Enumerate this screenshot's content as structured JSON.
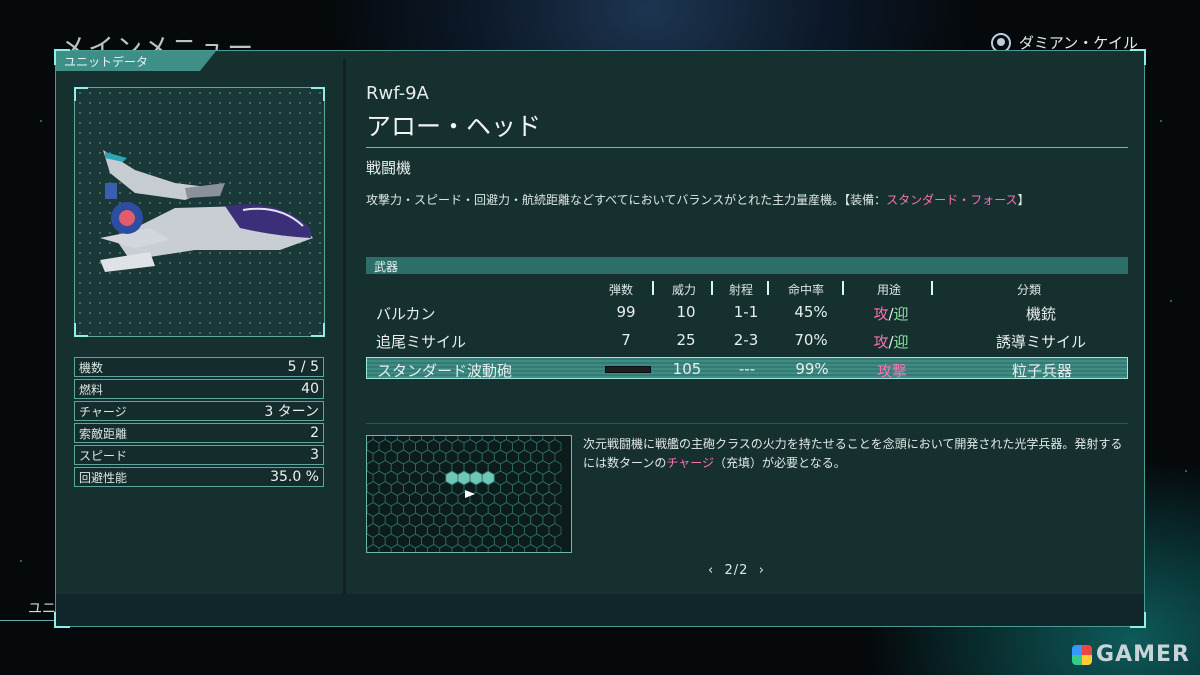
{
  "background": {
    "title": "メインメニュー",
    "pilot_name": "ダミアン・ケイル",
    "bottom_left_text": "ユニ"
  },
  "watermark": "GAMER",
  "panel": {
    "tab_label": "ユニットデータ",
    "unit_image_icon": "r9-fighter-ship",
    "stats": [
      {
        "label": "機数",
        "value": "5 / 5"
      },
      {
        "label": "燃料",
        "value": "40"
      },
      {
        "label": "チャージ",
        "value": "3 ターン"
      },
      {
        "label": "索敵距離",
        "value": "2"
      },
      {
        "label": "スピード",
        "value": "3"
      },
      {
        "label": "回避性能",
        "value": "35.0 %"
      }
    ],
    "model": "Rwf-9A",
    "name": "アロー・ヘッド",
    "type": "戦闘機",
    "description": {
      "text": "攻撃力・スピード・回避力・航続距離などすべてにおいてバランスがとれた主力量産機。【装備：",
      "highlight": "スタンダード・フォース",
      "suffix": "】"
    },
    "weapons_section_label": "武器",
    "weapon_headers": [
      "弾数",
      "威力",
      "射程",
      "命中率",
      "用途",
      "分類"
    ],
    "weapons": [
      {
        "name": "バルカン",
        "ammo": "99",
        "power": "10",
        "range": "1-1",
        "accuracy": "45%",
        "use_a": "攻",
        "use_sep": "/",
        "use_b": "迎",
        "category": "機銃"
      },
      {
        "name": "追尾ミサイル",
        "ammo": "7",
        "power": "25",
        "range": "2-3",
        "accuracy": "70%",
        "use_a": "攻",
        "use_sep": "/",
        "use_b": "迎",
        "category": "誘導ミサイル"
      },
      {
        "name": "スタンダード波動砲",
        "ammo": "",
        "power": "105",
        "range": "---",
        "accuracy": "99%",
        "use_a": "攻撃",
        "use_sep": "",
        "use_b": "",
        "category": "粒子兵器",
        "selected": true,
        "ammo_gauge": "charge-gauge"
      }
    ],
    "weapon_detail": {
      "text_1": "次元戦闘機に戦艦の主砲クラスの火力を持たせることを念頭において開発された光学兵器。発射するには数ターンの",
      "highlight": "チャージ",
      "text_2": "（充填）が必要となる。"
    },
    "pager": {
      "prev": "‹",
      "current": "2",
      "separator": "/",
      "total": "2",
      "next": "›"
    }
  },
  "colors": {
    "panel_bg": "#15302f",
    "accent": "#4c9a94",
    "highlight_pink": "#ff6fb3",
    "intercept_green": "#8fe0a6"
  }
}
